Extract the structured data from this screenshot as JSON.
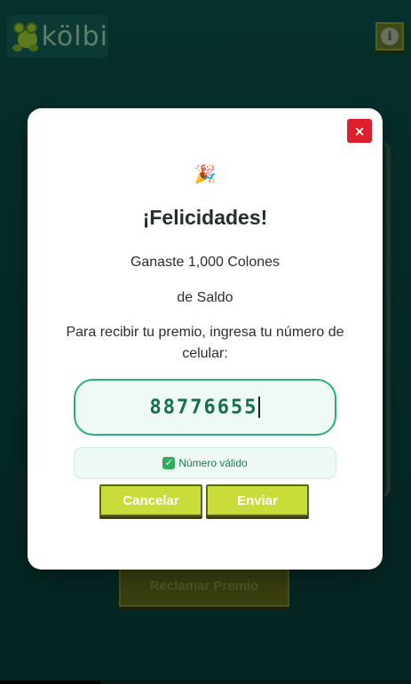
{
  "app": {
    "logo_text": "kölbi",
    "info_icon": "info-icon",
    "claim_button": "Reclamar Premio"
  },
  "modal": {
    "close_label": "×",
    "party_emoji": "🎉",
    "title": "¡Felicidades!",
    "prize_line": "Ganaste 1,000 Colones",
    "prize_line2": "de Saldo",
    "instruction": "Para recibir tu premio, ingresa tu número de celular:",
    "phone_value": "88776655",
    "validation_icon": "✓",
    "validation_text": "Número válido",
    "cancel_label": "Cancelar",
    "send_label": "Enviar"
  },
  "colors": {
    "accent": "#c8dd3a",
    "valid_green": "#27b07a",
    "close_red": "#dd1f2d"
  }
}
